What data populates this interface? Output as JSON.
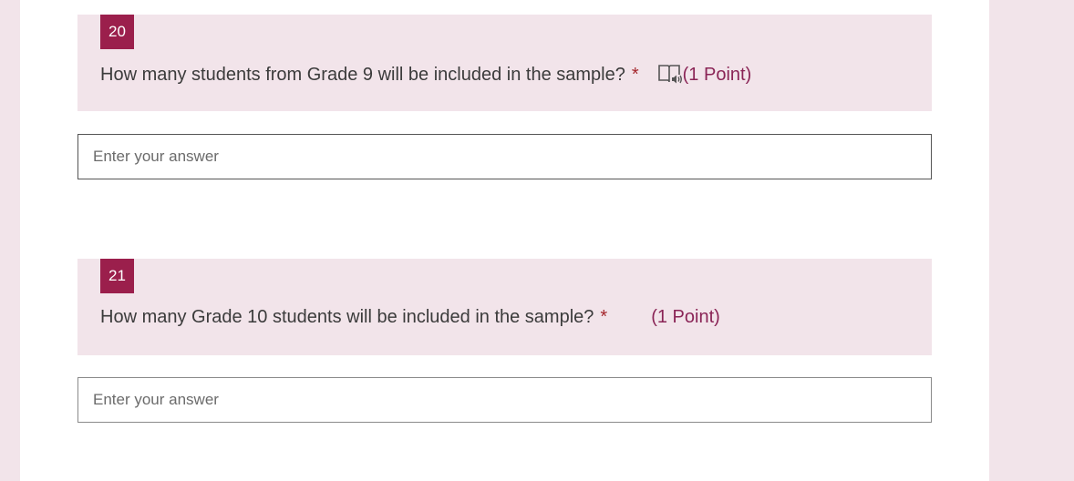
{
  "questions": [
    {
      "number": "20",
      "text": "How many students from Grade 9 will be included in the sample?",
      "required_mark": "*",
      "points": "(1 Point)",
      "answer_placeholder": "Enter your answer",
      "has_reader_icon": true
    },
    {
      "number": "21",
      "text": "How many Grade 10 students will be included in the sample?",
      "required_mark": "*",
      "points": "(1 Point)",
      "answer_placeholder": "Enter your answer",
      "has_reader_icon": false
    }
  ],
  "colors": {
    "accent": "#9b1f4c",
    "header_bg": "#f2e4ea",
    "points_text": "#8a2456",
    "required": "#a4262c"
  },
  "icons": {
    "reader": "immersive-reader-icon"
  }
}
